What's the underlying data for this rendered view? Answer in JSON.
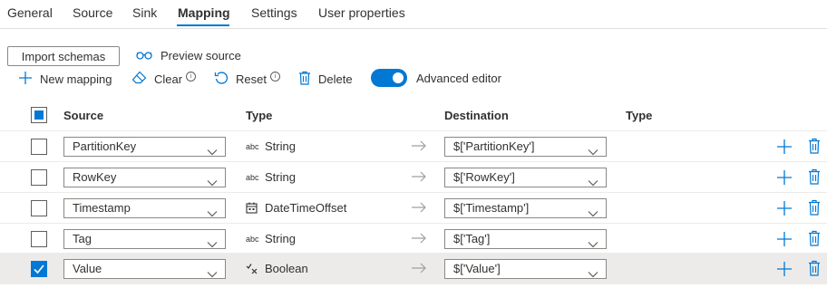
{
  "tabs": [
    "General",
    "Source",
    "Sink",
    "Mapping",
    "Settings",
    "User properties"
  ],
  "active_tab": "Mapping",
  "buttons": {
    "import_schemas": "Import schemas",
    "preview_source": "Preview source",
    "new_mapping": "New mapping",
    "clear": "Clear",
    "reset": "Reset",
    "delete": "Delete",
    "advanced_editor": "Advanced editor"
  },
  "advanced_editor_on": true,
  "headers": {
    "source": "Source",
    "type": "Type",
    "destination": "Destination",
    "type2": "Type"
  },
  "rows": [
    {
      "source": "PartitionKey",
      "type_icon": "abc",
      "type": "String",
      "destination": "$['PartitionKey']",
      "checked": false
    },
    {
      "source": "RowKey",
      "type_icon": "abc",
      "type": "String",
      "destination": "$['RowKey']",
      "checked": false
    },
    {
      "source": "Timestamp",
      "type_icon": "calendar-icon",
      "type": "DateTimeOffset",
      "destination": "$['Timestamp']",
      "checked": false
    },
    {
      "source": "Tag",
      "type_icon": "abc",
      "type": "String",
      "destination": "$['Tag']",
      "checked": false
    },
    {
      "source": "Value",
      "type_icon": "boolean-icon",
      "type": "Boolean",
      "destination": "$['Value']",
      "checked": true
    }
  ],
  "colors": {
    "accent": "#0078d4",
    "selected_row": "#edebe9"
  }
}
